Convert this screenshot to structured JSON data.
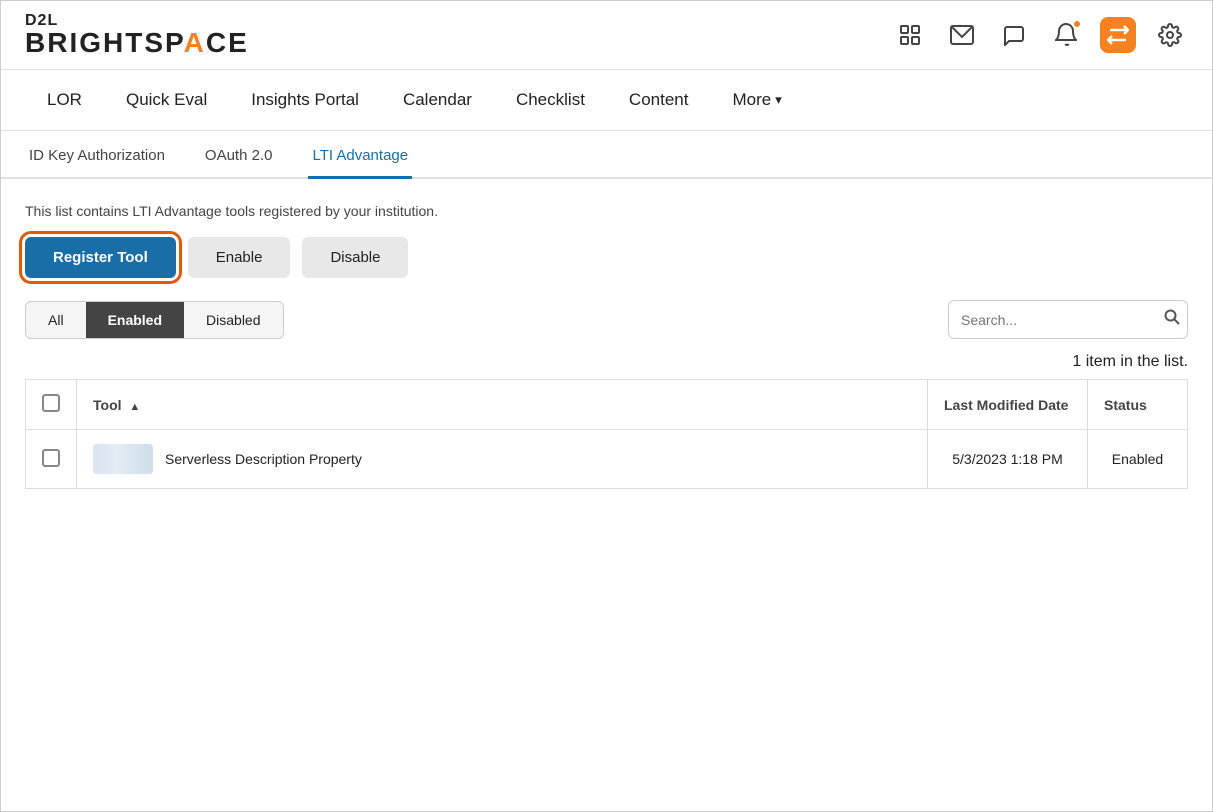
{
  "logo": {
    "d2l": "D2L",
    "brightspace_before": "BRIGHTSP",
    "brightspace_accent": "A",
    "brightspace_after": "CE"
  },
  "header_icons": {
    "grid_label": "grid-icon",
    "mail_label": "mail-icon",
    "chat_label": "chat-icon",
    "bell_label": "bell-icon",
    "swap_label": "swap-icon",
    "settings_label": "settings-icon"
  },
  "nav": {
    "items": [
      "LOR",
      "Quick Eval",
      "Insights Portal",
      "Calendar",
      "Checklist",
      "Content"
    ],
    "more_label": "More"
  },
  "tabs": {
    "items": [
      "ID Key Authorization",
      "OAuth 2.0",
      "LTI Advantage"
    ],
    "active_index": 2
  },
  "content": {
    "description": "This list contains LTI Advantage tools registered by your institution.",
    "register_button": "Register Tool",
    "enable_button": "Enable",
    "disable_button": "Disable",
    "filter_tabs": [
      "All",
      "Enabled",
      "Disabled"
    ],
    "active_filter_index": 1,
    "search_placeholder": "Search...",
    "search_label": "Search :",
    "item_count": "1 item in the list.",
    "table": {
      "headers": [
        "",
        "Tool",
        "Last Modified Date",
        "Status"
      ],
      "rows": [
        {
          "tool_name": "Serverless Description Property",
          "last_modified": "5/3/2023 1:18 PM",
          "status": "Enabled"
        }
      ]
    }
  }
}
